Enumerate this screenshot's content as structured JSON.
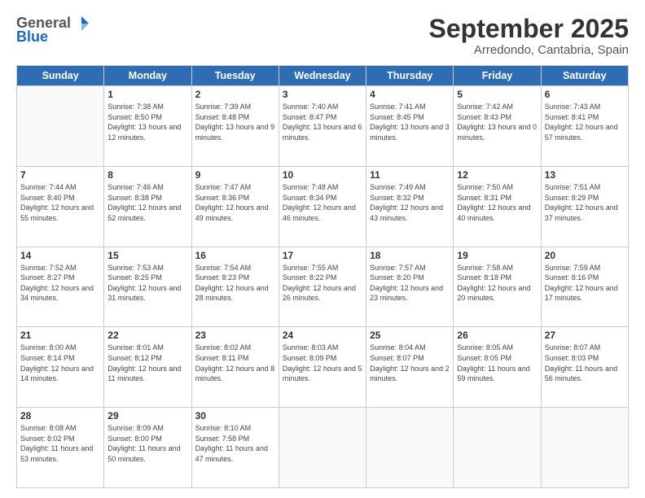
{
  "header": {
    "logo_general": "General",
    "logo_blue": "Blue",
    "title": "September 2025",
    "subtitle": "Arredondo, Cantabria, Spain"
  },
  "weekdays": [
    "Sunday",
    "Monday",
    "Tuesday",
    "Wednesday",
    "Thursday",
    "Friday",
    "Saturday"
  ],
  "weeks": [
    [
      {
        "day": "",
        "sunrise": "",
        "sunset": "",
        "daylight": ""
      },
      {
        "day": "1",
        "sunrise": "Sunrise: 7:38 AM",
        "sunset": "Sunset: 8:50 PM",
        "daylight": "Daylight: 13 hours and 12 minutes."
      },
      {
        "day": "2",
        "sunrise": "Sunrise: 7:39 AM",
        "sunset": "Sunset: 8:48 PM",
        "daylight": "Daylight: 13 hours and 9 minutes."
      },
      {
        "day": "3",
        "sunrise": "Sunrise: 7:40 AM",
        "sunset": "Sunset: 8:47 PM",
        "daylight": "Daylight: 13 hours and 6 minutes."
      },
      {
        "day": "4",
        "sunrise": "Sunrise: 7:41 AM",
        "sunset": "Sunset: 8:45 PM",
        "daylight": "Daylight: 13 hours and 3 minutes."
      },
      {
        "day": "5",
        "sunrise": "Sunrise: 7:42 AM",
        "sunset": "Sunset: 8:43 PM",
        "daylight": "Daylight: 13 hours and 0 minutes."
      },
      {
        "day": "6",
        "sunrise": "Sunrise: 7:43 AM",
        "sunset": "Sunset: 8:41 PM",
        "daylight": "Daylight: 12 hours and 57 minutes."
      }
    ],
    [
      {
        "day": "7",
        "sunrise": "Sunrise: 7:44 AM",
        "sunset": "Sunset: 8:40 PM",
        "daylight": "Daylight: 12 hours and 55 minutes."
      },
      {
        "day": "8",
        "sunrise": "Sunrise: 7:46 AM",
        "sunset": "Sunset: 8:38 PM",
        "daylight": "Daylight: 12 hours and 52 minutes."
      },
      {
        "day": "9",
        "sunrise": "Sunrise: 7:47 AM",
        "sunset": "Sunset: 8:36 PM",
        "daylight": "Daylight: 12 hours and 49 minutes."
      },
      {
        "day": "10",
        "sunrise": "Sunrise: 7:48 AM",
        "sunset": "Sunset: 8:34 PM",
        "daylight": "Daylight: 12 hours and 46 minutes."
      },
      {
        "day": "11",
        "sunrise": "Sunrise: 7:49 AM",
        "sunset": "Sunset: 8:32 PM",
        "daylight": "Daylight: 12 hours and 43 minutes."
      },
      {
        "day": "12",
        "sunrise": "Sunrise: 7:50 AM",
        "sunset": "Sunset: 8:31 PM",
        "daylight": "Daylight: 12 hours and 40 minutes."
      },
      {
        "day": "13",
        "sunrise": "Sunrise: 7:51 AM",
        "sunset": "Sunset: 8:29 PM",
        "daylight": "Daylight: 12 hours and 37 minutes."
      }
    ],
    [
      {
        "day": "14",
        "sunrise": "Sunrise: 7:52 AM",
        "sunset": "Sunset: 8:27 PM",
        "daylight": "Daylight: 12 hours and 34 minutes."
      },
      {
        "day": "15",
        "sunrise": "Sunrise: 7:53 AM",
        "sunset": "Sunset: 8:25 PM",
        "daylight": "Daylight: 12 hours and 31 minutes."
      },
      {
        "day": "16",
        "sunrise": "Sunrise: 7:54 AM",
        "sunset": "Sunset: 8:23 PM",
        "daylight": "Daylight: 12 hours and 28 minutes."
      },
      {
        "day": "17",
        "sunrise": "Sunrise: 7:55 AM",
        "sunset": "Sunset: 8:22 PM",
        "daylight": "Daylight: 12 hours and 26 minutes."
      },
      {
        "day": "18",
        "sunrise": "Sunrise: 7:57 AM",
        "sunset": "Sunset: 8:20 PM",
        "daylight": "Daylight: 12 hours and 23 minutes."
      },
      {
        "day": "19",
        "sunrise": "Sunrise: 7:58 AM",
        "sunset": "Sunset: 8:18 PM",
        "daylight": "Daylight: 12 hours and 20 minutes."
      },
      {
        "day": "20",
        "sunrise": "Sunrise: 7:59 AM",
        "sunset": "Sunset: 8:16 PM",
        "daylight": "Daylight: 12 hours and 17 minutes."
      }
    ],
    [
      {
        "day": "21",
        "sunrise": "Sunrise: 8:00 AM",
        "sunset": "Sunset: 8:14 PM",
        "daylight": "Daylight: 12 hours and 14 minutes."
      },
      {
        "day": "22",
        "sunrise": "Sunrise: 8:01 AM",
        "sunset": "Sunset: 8:12 PM",
        "daylight": "Daylight: 12 hours and 11 minutes."
      },
      {
        "day": "23",
        "sunrise": "Sunrise: 8:02 AM",
        "sunset": "Sunset: 8:11 PM",
        "daylight": "Daylight: 12 hours and 8 minutes."
      },
      {
        "day": "24",
        "sunrise": "Sunrise: 8:03 AM",
        "sunset": "Sunset: 8:09 PM",
        "daylight": "Daylight: 12 hours and 5 minutes."
      },
      {
        "day": "25",
        "sunrise": "Sunrise: 8:04 AM",
        "sunset": "Sunset: 8:07 PM",
        "daylight": "Daylight: 12 hours and 2 minutes."
      },
      {
        "day": "26",
        "sunrise": "Sunrise: 8:05 AM",
        "sunset": "Sunset: 8:05 PM",
        "daylight": "Daylight: 11 hours and 59 minutes."
      },
      {
        "day": "27",
        "sunrise": "Sunrise: 8:07 AM",
        "sunset": "Sunset: 8:03 PM",
        "daylight": "Daylight: 11 hours and 56 minutes."
      }
    ],
    [
      {
        "day": "28",
        "sunrise": "Sunrise: 8:08 AM",
        "sunset": "Sunset: 8:02 PM",
        "daylight": "Daylight: 11 hours and 53 minutes."
      },
      {
        "day": "29",
        "sunrise": "Sunrise: 8:09 AM",
        "sunset": "Sunset: 8:00 PM",
        "daylight": "Daylight: 11 hours and 50 minutes."
      },
      {
        "day": "30",
        "sunrise": "Sunrise: 8:10 AM",
        "sunset": "Sunset: 7:58 PM",
        "daylight": "Daylight: 11 hours and 47 minutes."
      },
      {
        "day": "",
        "sunrise": "",
        "sunset": "",
        "daylight": ""
      },
      {
        "day": "",
        "sunrise": "",
        "sunset": "",
        "daylight": ""
      },
      {
        "day": "",
        "sunrise": "",
        "sunset": "",
        "daylight": ""
      },
      {
        "day": "",
        "sunrise": "",
        "sunset": "",
        "daylight": ""
      }
    ]
  ]
}
